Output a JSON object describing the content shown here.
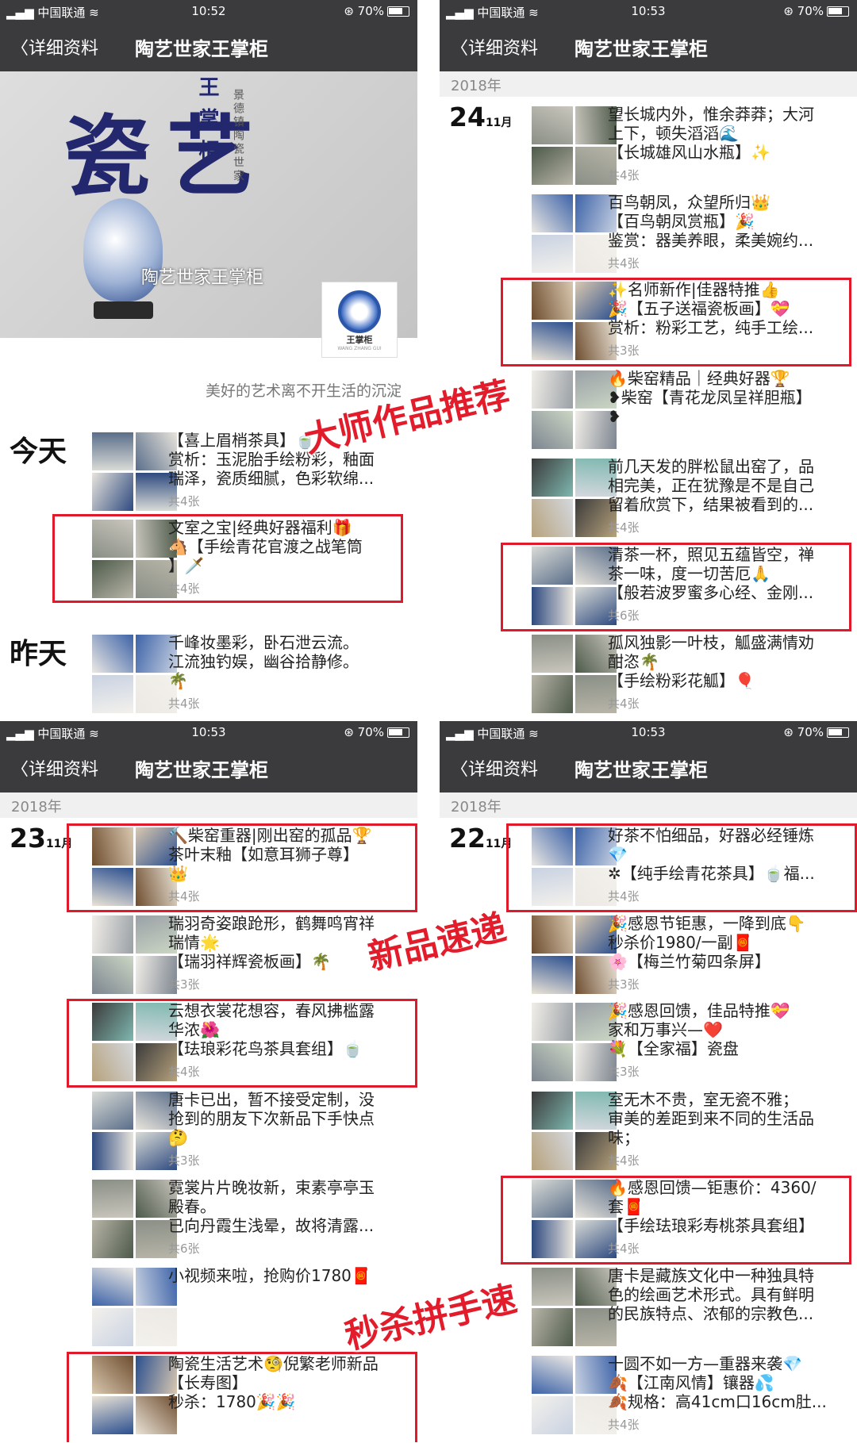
{
  "status": {
    "carrier": "中国联通",
    "battery": "70%"
  },
  "nav": {
    "back": "详细资料",
    "title": "陶艺世家王掌柜"
  },
  "panels": [
    {
      "time": "10:52",
      "cover": {
        "art_text": "瓷艺",
        "vertical_title": "王掌柜",
        "vertical_sub": "景德镇陶瓷世家",
        "brand": "陶艺世家王掌柜",
        "logo": "王掌柜",
        "logo_sub": "WANG ZHANG GUI"
      },
      "signature": "美好的艺术离不开生活的沉淀",
      "day_labels": [
        "今天",
        "昨天"
      ],
      "posts": [
        {
          "lines": [
            "【喜上眉梢茶具】🍵",
            "赏析：玉泥胎手绘粉彩，釉面",
            "瑞泽，瓷质细腻，色彩软绵..."
          ],
          "count": "共4张"
        },
        {
          "lines": [
            "文室之宝|经典好器福利🎁",
            "🐴【手绘青花官渡之战笔筒",
            "】🗡️"
          ],
          "count": "共4张"
        },
        {
          "lines": [
            "千峰妆墨彩，卧石泄云流。",
            "江流独钓娱，幽谷拾静修。",
            "🌴"
          ],
          "count": "共4张"
        }
      ],
      "stamp": "大师作品推荐"
    },
    {
      "time": "10:53",
      "year": "2018年",
      "day": "24",
      "month": "11月",
      "posts": [
        {
          "lines": [
            "望长城内外，惟余莽莽；大河",
            "上下，顿失滔滔🌊",
            "【长城雄风山水瓶】✨"
          ],
          "count": "共4张"
        },
        {
          "lines": [
            "百鸟朝凤，众望所归👑",
            "【百鸟朝凤赏瓶】🎉",
            "鉴赏：器美养眼，柔美婉约..."
          ],
          "count": "共4张"
        },
        {
          "lines": [
            "✨名师新作|佳器特推👍",
            "🎉【五子送福瓷板画】💝",
            "赏析：粉彩工艺，纯手工绘..."
          ],
          "count": "共3张"
        },
        {
          "lines": [
            "🔥柴窑精品｜经典好器🏆",
            "❥柴窑【青花龙凤呈祥胆瓶】",
            "❥"
          ],
          "count": ""
        },
        {
          "lines": [
            "前几天发的胖松鼠出窑了，品",
            "相完美，正在犹豫是不是自己",
            "留着欣赏下，结果被看到的..."
          ],
          "count": "共4张"
        },
        {
          "lines": [
            "清茶一杯，照见五蕴皆空，禅",
            "茶一味，度一切苦厄🙏",
            "【般若波罗蜜多心经、金刚..."
          ],
          "count": "共6张"
        },
        {
          "lines": [
            "孤风独影一叶枝，觚盛满情劝",
            "酣恣🌴",
            "【手绘粉彩花觚】🎈"
          ],
          "count": "共4张"
        }
      ]
    },
    {
      "time": "10:53",
      "year": "2018年",
      "day": "23",
      "month": "11月",
      "posts": [
        {
          "lines": [
            "🔨柴窑重器|刚出窑的孤品🏆",
            "茶叶末釉【如意耳狮子尊】",
            "👑"
          ],
          "count": "共4张"
        },
        {
          "lines": [
            "瑞羽奇姿踉跄形，鹤舞鸣宵祥",
            "瑞情🌟",
            "【瑞羽祥辉瓷板画】🌴"
          ],
          "count": "共3张"
        },
        {
          "lines": [
            "云想衣裳花想容，春风拂槛露",
            "华浓🌺",
            "【珐琅彩花鸟茶具套组】🍵"
          ],
          "count": "共4张"
        },
        {
          "lines": [
            "唐卡已出，暂不接受定制，没",
            "抢到的朋友下次新品下手快点",
            "🤔"
          ],
          "count": "共3张"
        },
        {
          "lines": [
            "霓裳片片晚妆新，束素亭亭玉",
            "殿春。",
            "已向丹霞生浅晕，故将清露..."
          ],
          "count": "共6张"
        },
        {
          "lines": [
            "小视频来啦，抢购价1780🧧"
          ],
          "count": ""
        },
        {
          "lines": [
            "陶瓷生活艺术🧐倪繁老师新品",
            "【长寿图】",
            "秒杀：1780🎉🎉"
          ],
          "count": ""
        }
      ],
      "stamps": [
        "新品速递",
        "秒杀拼手速"
      ]
    },
    {
      "time": "10:53",
      "year": "2018年",
      "day": "22",
      "month": "11月",
      "posts": [
        {
          "lines": [
            "好茶不怕细品，好器必经锤炼",
            "💎",
            "✲【纯手绘青花茶具】🍵福..."
          ],
          "count": "共4张"
        },
        {
          "lines": [
            "🎉感恩节钜惠，一降到底👇",
            "秒杀价1980/一副🧧",
            "🌸【梅兰竹菊四条屏】"
          ],
          "count": "共3张"
        },
        {
          "lines": [
            "🎉感恩回馈，佳品特推💝",
            "家和万事兴—❤️",
            "💐【全家福】瓷盘"
          ],
          "count": "共3张"
        },
        {
          "lines": [
            "室无木不贵，室无瓷不雅；",
            "审美的差距到来不同的生活品",
            "味；"
          ],
          "count": "共4张"
        },
        {
          "lines": [
            "🔥感恩回馈—钜惠价：4360/",
            "套🧧",
            "【手绘珐琅彩寿桃茶具套组】"
          ],
          "count": "共4张"
        },
        {
          "lines": [
            "唐卡是藏族文化中一种独具特",
            "色的绘画艺术形式。具有鲜明",
            "的民族特点、浓郁的宗教色..."
          ],
          "count": ""
        },
        {
          "lines": [
            "十圆不如一方—重器来袭💎",
            "🍂【江南风情】镶器💦",
            "🍂规格：高41cm口16cm肚..."
          ],
          "count": "共4张"
        }
      ]
    }
  ]
}
